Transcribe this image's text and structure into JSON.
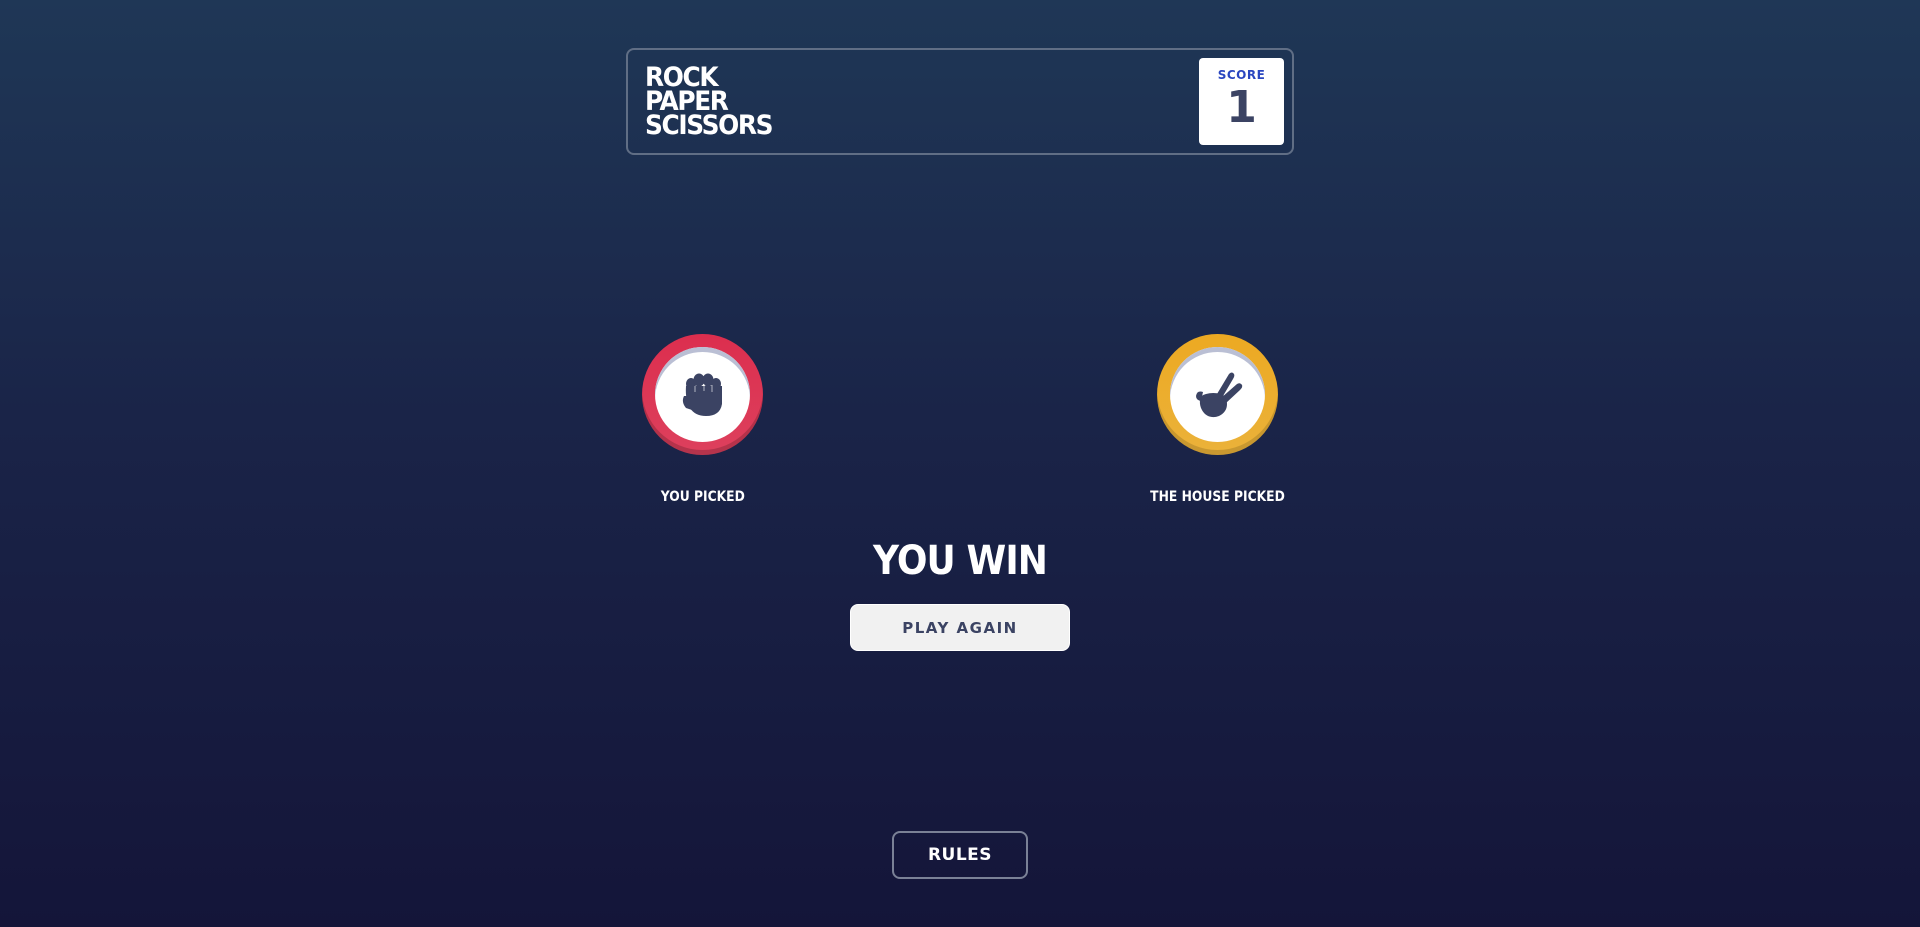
{
  "header": {
    "title_lines": [
      "ROCK",
      "PAPER",
      "SCISSORS"
    ],
    "score_label": "SCORE",
    "score_value": "1"
  },
  "player": {
    "label": "YOU PICKED",
    "choice": "rock",
    "icon": "rock-hand-icon",
    "ring_color": "#dc2e4e"
  },
  "house": {
    "label": "THE HOUSE PICKED",
    "choice": "scissors",
    "icon": "scissors-hand-icon",
    "ring_color": "#eca922"
  },
  "result": {
    "text": "YOU WIN",
    "play_again_label": "PLAY AGAIN"
  },
  "footer": {
    "rules_label": "RULES"
  },
  "colors": {
    "background_top": "#1f3756",
    "background_bottom": "#141539",
    "score_label": "#2a46c0",
    "dark_text": "#3b4363"
  }
}
